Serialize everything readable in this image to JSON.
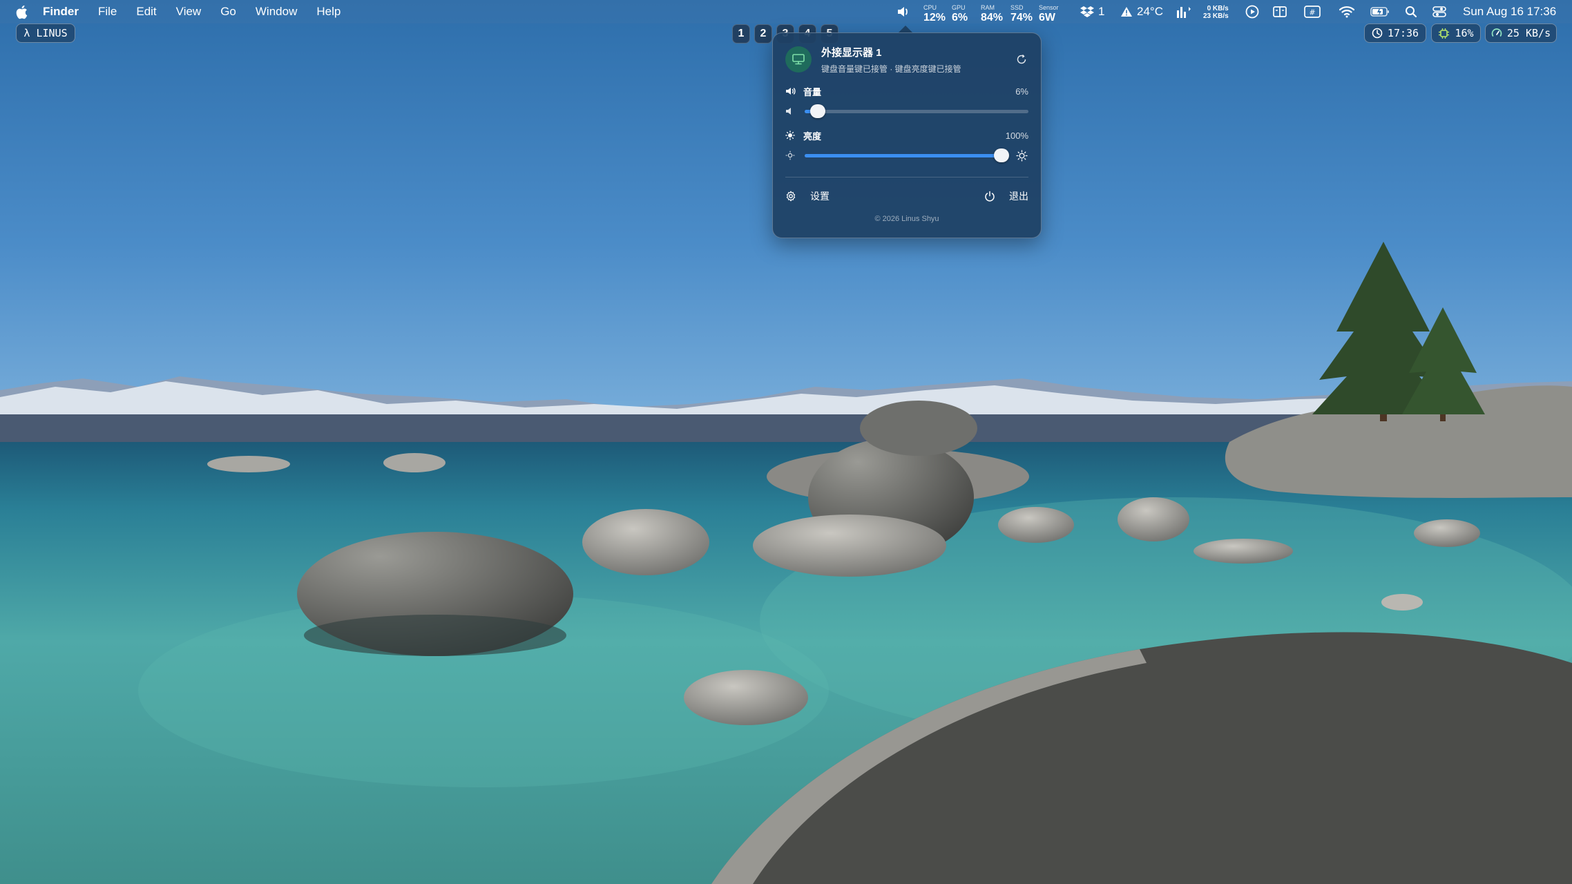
{
  "menubar": {
    "app_name": "Finder",
    "menus": [
      "File",
      "Edit",
      "View",
      "Go",
      "Window",
      "Help"
    ]
  },
  "status": {
    "cpu": {
      "label": "CPU",
      "value": "12%"
    },
    "gpu": {
      "label": "GPU",
      "value": "6%"
    },
    "ram": {
      "label": "RAM",
      "value": "84%"
    },
    "ssd": {
      "label": "SSD",
      "value": "74%"
    },
    "sensor": {
      "label": "Sensor",
      "value": "6W"
    },
    "dropbox_count": "1",
    "temperature": "24°C",
    "net_up": "0 KB/s",
    "net_down": "23 KB/s",
    "datetime": "Sun Aug 16  17:36"
  },
  "pills": {
    "user": "λ LINUS",
    "clock": "17:36",
    "cpu": "16%",
    "network": "25 KB/s"
  },
  "workspaces": [
    "1",
    "2",
    "3",
    "4",
    "5"
  ],
  "popup": {
    "title": "外接显示器 1",
    "subtitle": "键盘音量键已接管 · 键盘亮度键已接管",
    "volume_label": "音量",
    "volume_value": "6%",
    "volume_level": 0.06,
    "brightness_label": "亮度",
    "brightness_value": "100%",
    "brightness_level": 1.0,
    "settings_label": "设置",
    "quit_label": "退出",
    "copyright": "© 2026 Linus Shyu",
    "accent_color": "#3b8ff2"
  },
  "icons": {
    "apple": "apple-icon",
    "speaker": "speaker-icon",
    "dropbox": "dropbox-icon",
    "warning": "warning-icon",
    "activity": "activity-icon",
    "play": "play-icon",
    "split": "split-view-icon",
    "shortcut": "shortcut-icon",
    "wifi": "wifi-icon",
    "battery": "battery-icon",
    "search": "search-icon",
    "control_center": "control-center-icon",
    "clock": "clock-icon",
    "cpu_chip": "cpu-chip-icon",
    "gauge": "gauge-icon",
    "display": "display-icon",
    "refresh": "refresh-icon",
    "sun": "sun-icon",
    "gear": "gear-icon",
    "power": "power-icon"
  }
}
